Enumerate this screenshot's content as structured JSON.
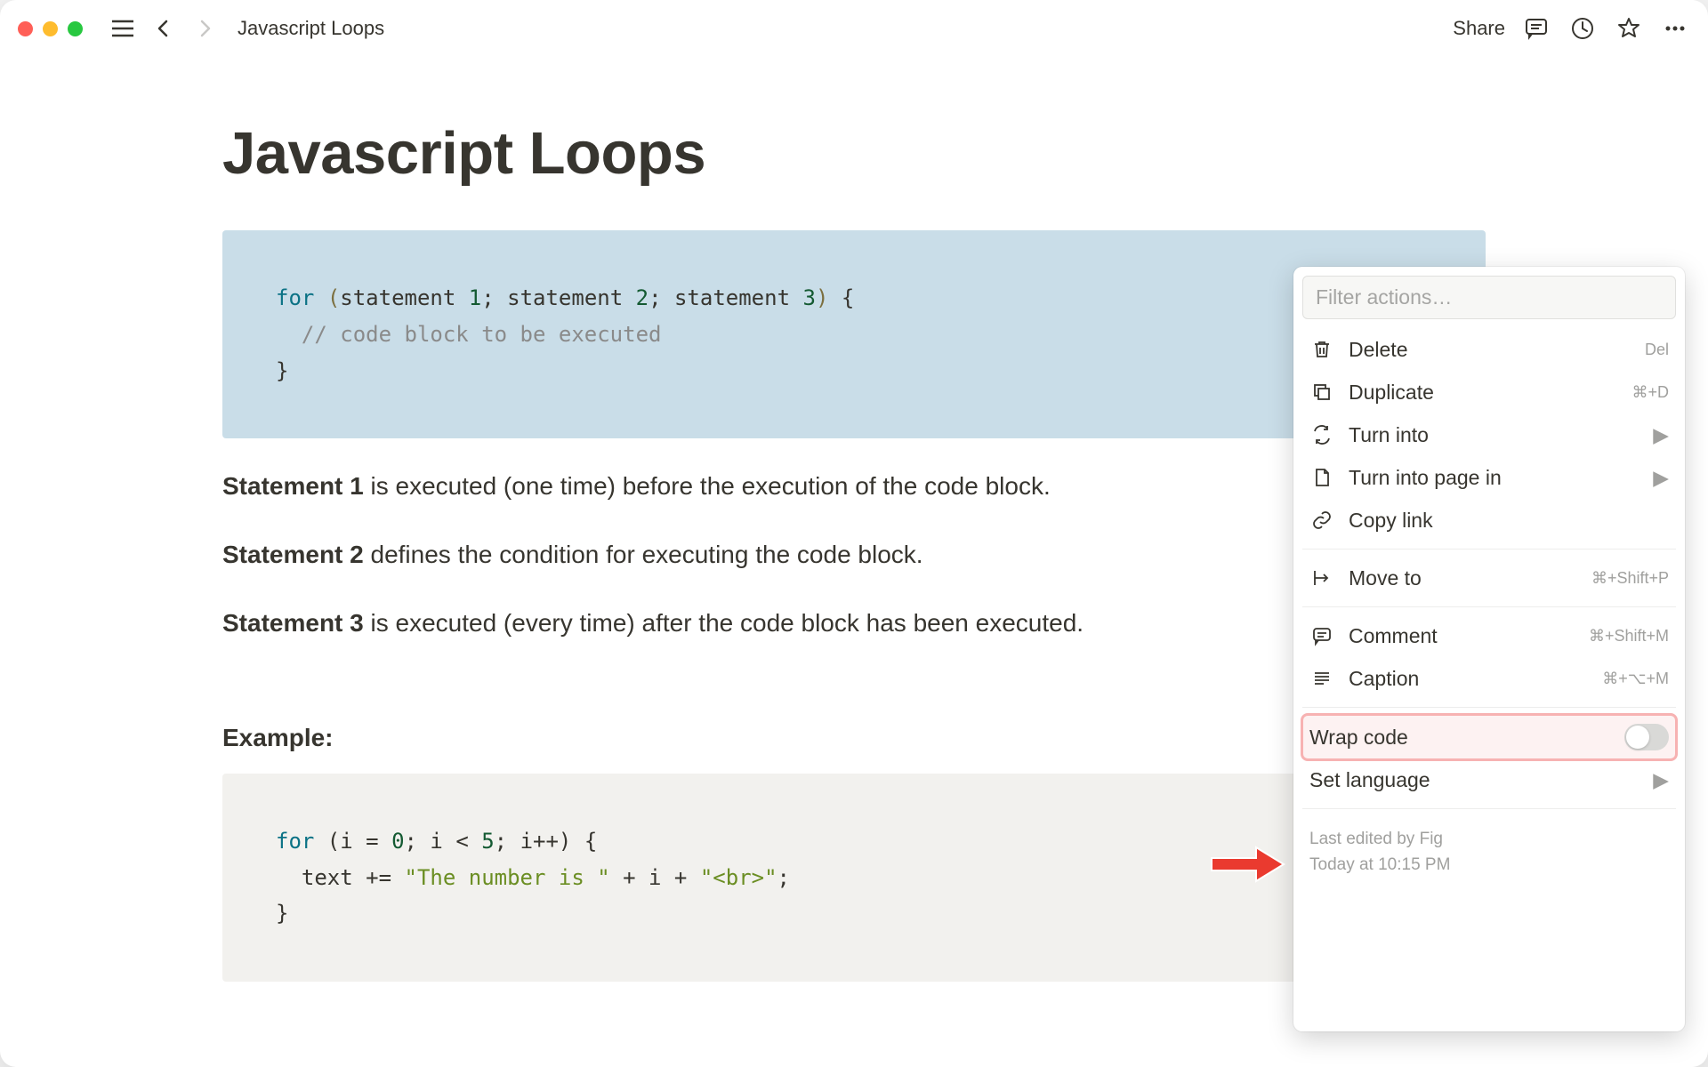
{
  "topbar": {
    "breadcrumb": "Javascript Loops",
    "share": "Share"
  },
  "page": {
    "title": "Javascript Loops",
    "code1": {
      "keyword": "for",
      "lp": "(",
      "s1": "statement ",
      "n1": "1",
      "sep1": "; ",
      "s2": "statement ",
      "n2": "2",
      "sep2": "; ",
      "s3": "statement ",
      "n3": "3",
      "rp": ")",
      "brace": " {",
      "comment": "  // code block to be executed",
      "cbrace": "}"
    },
    "para1_bold": "Statement 1",
    "para1_rest": " is executed (one time) before the execution of the code block.",
    "para2_bold": "Statement 2",
    "para2_rest": " defines the condition for executing the code block.",
    "para3_bold": "Statement 3",
    "para3_rest": " is executed (every time) after the code block has been executed.",
    "example_label": "Example:",
    "code2": {
      "kw": "for",
      "lp": " (",
      "v1": "i = ",
      "n0": "0",
      "sep1": "; i < ",
      "n5": "5",
      "sep2": "; i++) {",
      "line2a": "  text += ",
      "str1": "\"The number is \"",
      "plus1": " + i + ",
      "str2": "\"<br>\"",
      "semi": ";",
      "cbrace": "}"
    }
  },
  "menu": {
    "filter_placeholder": "Filter actions…",
    "items": {
      "delete": {
        "label": "Delete",
        "kbd": "Del"
      },
      "duplicate": {
        "label": "Duplicate",
        "kbd": "⌘+D"
      },
      "turn_into": {
        "label": "Turn into"
      },
      "turn_into_page": {
        "label": "Turn into page in"
      },
      "copy_link": {
        "label": "Copy link"
      },
      "move_to": {
        "label": "Move to",
        "kbd": "⌘+Shift+P"
      },
      "comment": {
        "label": "Comment",
        "kbd": "⌘+Shift+M"
      },
      "caption": {
        "label": "Caption",
        "kbd": "⌘+⌥+M"
      },
      "wrap_code": {
        "label": "Wrap code"
      },
      "set_language": {
        "label": "Set language"
      }
    },
    "footer_line1": "Last edited by Fig",
    "footer_line2": "Today at 10:15 PM"
  }
}
